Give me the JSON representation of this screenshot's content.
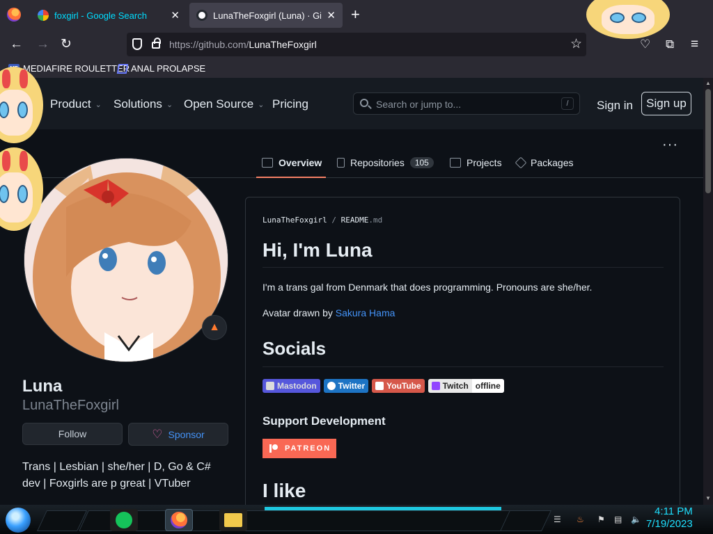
{
  "browser": {
    "tabs": [
      {
        "title": "foxgirl - Google Search",
        "active": false
      },
      {
        "title": "LunaTheFoxgirl (Luna) · GitHub",
        "active": true
      }
    ],
    "new_tab_label": "+",
    "close_glyph": "✕",
    "url_host": "https://github.com/",
    "url_path": "LunaTheFoxgirl",
    "bookmarks": [
      {
        "label": "MEDIAFIRE ROULETTER",
        "icon": "MF"
      },
      {
        "label": "ANAL PROLAPSE",
        "icon": "sigma-icon"
      }
    ]
  },
  "github": {
    "nav": [
      "Product",
      "Solutions",
      "Open Source",
      "Pricing"
    ],
    "search_placeholder": "Search or jump to...",
    "search_shortcut": "/",
    "sign_in": "Sign in",
    "sign_up": "Sign up"
  },
  "profile_tabs": [
    {
      "label": "Overview",
      "count": "",
      "active": true
    },
    {
      "label": "Repositories",
      "count": "105",
      "active": false
    },
    {
      "label": "Projects",
      "count": "",
      "active": false
    },
    {
      "label": "Packages",
      "count": "",
      "active": false
    }
  ],
  "profile": {
    "name": "Luna",
    "login": "LunaTheFoxgirl",
    "follow": "Follow",
    "sponsor": "Sponsor",
    "bio": "Trans | Lesbian | she/her | D, Go & C# dev | Foxgirls are p great | VTuber"
  },
  "readme": {
    "repo": "LunaTheFoxgirl",
    "file": "README",
    "ext": ".md",
    "heading": "Hi, I'm Luna",
    "intro": "I'm a trans gal from Denmark that does programming. Pronouns are she/her.",
    "avatar_prefix": "Avatar drawn by ",
    "avatar_artist": "Sakura Hama",
    "socials_heading": "Socials",
    "badges": [
      {
        "label": "Mastodon",
        "color": "#6364ff"
      },
      {
        "label": "Twitter",
        "color": "#1d74c4"
      },
      {
        "label": "YouTube",
        "color": "#d6584a"
      },
      {
        "label": "Twitch",
        "color": "#e9e9e9"
      },
      {
        "label": "offline",
        "color": "#ffffff"
      }
    ],
    "support_heading": "Support Development",
    "patreon": "PATREON",
    "like_heading": "I like"
  },
  "taskbar": {
    "time": "4:11 PM",
    "date": "7/19/2023"
  },
  "colors": {
    "accent_link": "#4493f8",
    "tab_underline": "#f78166",
    "patreon": "#f96854",
    "clock": "#1ee0ff"
  }
}
